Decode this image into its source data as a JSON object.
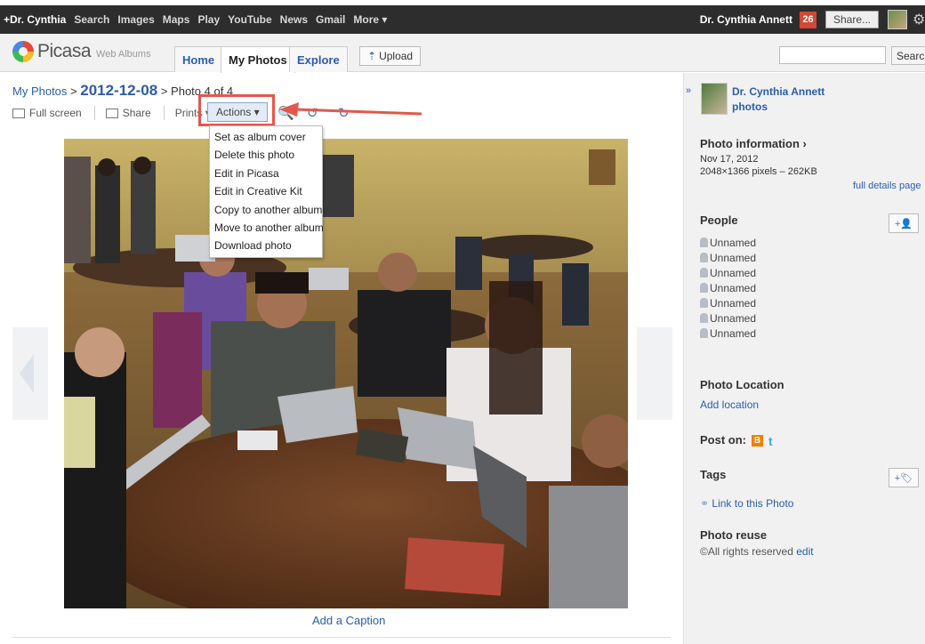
{
  "gbar": {
    "links": [
      "+Dr. Cynthia",
      "Search",
      "Images",
      "Maps",
      "Play",
      "YouTube",
      "News",
      "Gmail",
      "More ▾"
    ],
    "user_name": "Dr. Cynthia Annett",
    "notification_count": "26",
    "share_label": "Share..."
  },
  "header": {
    "logo_text": "Picasa",
    "logo_sub": "Web Albums",
    "tabs": [
      "Home",
      "My Photos",
      "Explore"
    ],
    "upload_label": "Upload",
    "search_label": "Search"
  },
  "breadcrumb": {
    "root": "My Photos",
    "sep1": " > ",
    "album": "2012-12-08",
    "sep2": " > ",
    "current": "Photo 4 of 4"
  },
  "toolbar": {
    "fullscreen": "Full screen",
    "share": "Share",
    "prints": "Prints ▾",
    "actions": "Actions ▾"
  },
  "actions_menu": [
    "Set as album cover",
    "Delete this photo",
    "Edit in Picasa",
    "Edit in Creative Kit",
    "Copy to another album",
    "Move to another album",
    "Download photo"
  ],
  "caption_link": "Add a Caption",
  "sidebar": {
    "collapse": "»",
    "owner_name": "Dr. Cynthia Annett",
    "owner_photos": "photos",
    "photo_info_title": "Photo information ›",
    "photo_date": "Nov 17, 2012",
    "photo_dims": "2048×1366 pixels – 262KB",
    "full_details": "full details page",
    "people_title": "People",
    "people": [
      "Unnamed",
      "Unnamed",
      "Unnamed",
      "Unnamed",
      "Unnamed",
      "Unnamed",
      "Unnamed"
    ],
    "location_title": "Photo Location",
    "add_location": "Add location",
    "post_on": "Post on:",
    "tags_title": "Tags",
    "link_to_photo": "Link to this Photo",
    "reuse_title": "Photo reuse",
    "rights": "All rights reserved",
    "edit": "edit"
  }
}
